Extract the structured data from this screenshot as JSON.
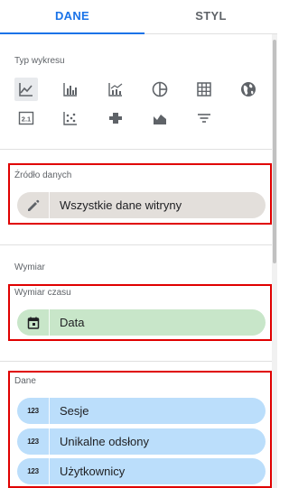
{
  "tabs": {
    "dane": "DANE",
    "styl": "STYL"
  },
  "chart_type": {
    "title": "Typ wykresu",
    "icons_row1": [
      "time-series-chart-icon",
      "column-chart-icon",
      "combo-chart-icon",
      "pie-chart-icon",
      "table-chart-icon",
      "geo-map-icon"
    ],
    "icons_row2": [
      "scorecard-icon",
      "scatter-chart-icon",
      "bullet-chart-icon",
      "area-chart-icon",
      "filter-icon"
    ],
    "scorecard_text": "2.1",
    "selected": "time-series-chart-icon"
  },
  "data_source": {
    "title": "Źródło danych",
    "value": "Wszystkie dane witryny",
    "icon": "pencil-icon"
  },
  "dimension": {
    "title": "Wymiar"
  },
  "time_dimension": {
    "title": "Wymiar czasu",
    "value": "Data",
    "icon": "calendar-icon"
  },
  "metrics": {
    "title": "Dane",
    "badge": "123",
    "items": [
      "Sesje",
      "Unikalne odsłony",
      "Użytkownicy"
    ]
  },
  "colors": {
    "accent": "#1a73e8",
    "highlight": "#e00000",
    "source_chip": "#e3dfdb",
    "dimension_chip": "#c8e6c9",
    "metric_chip": "#bbdefb"
  }
}
